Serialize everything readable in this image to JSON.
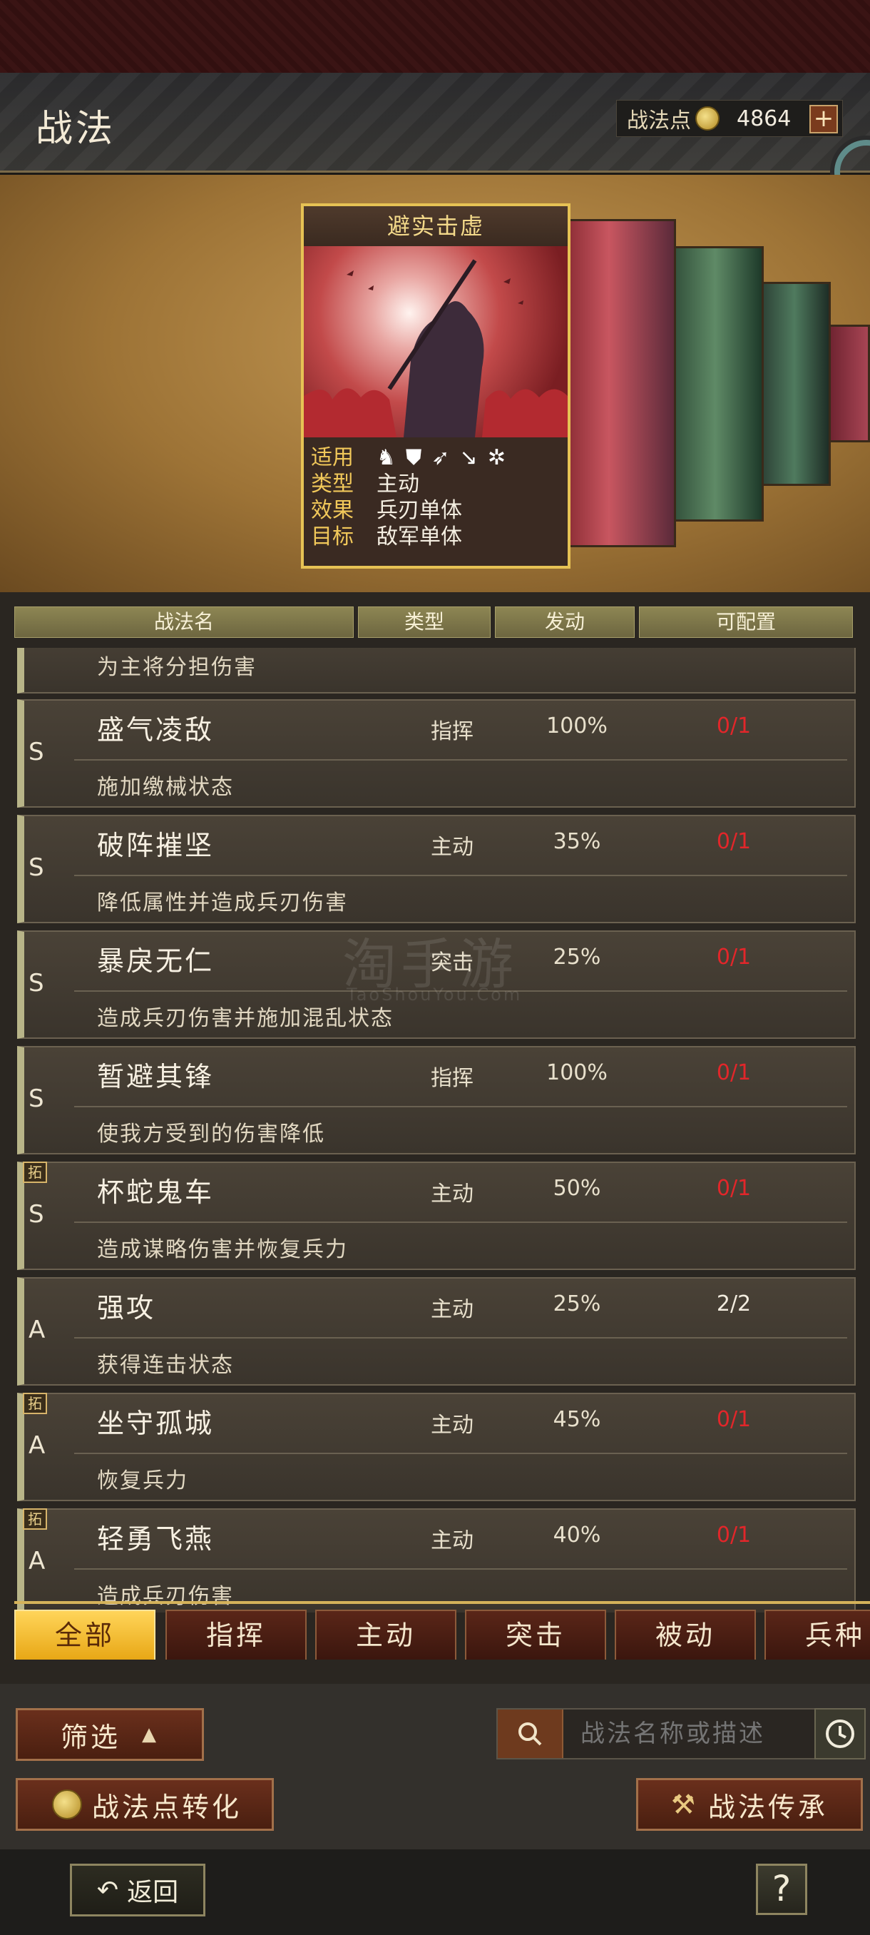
{
  "header": {
    "title": "战法",
    "points_label": "战法点",
    "points_value": "4864",
    "plus_label": "+"
  },
  "featured_card": {
    "name": "避实击虚",
    "fields": [
      {
        "key": "适用",
        "icons": [
          "cavalry-icon",
          "shield-icon",
          "archer-icon",
          "spear-icon",
          "siege-wheel-icon"
        ]
      },
      {
        "key": "类型",
        "value": "主动"
      },
      {
        "key": "效果",
        "value": "兵刃单体"
      },
      {
        "key": "目标",
        "value": "敌军单体"
      }
    ]
  },
  "columns": [
    "战法名",
    "类型",
    "发动",
    "可配置"
  ],
  "partial_top_desc": "为主将分担伤害",
  "rows": [
    {
      "grade": "S",
      "tag": "",
      "name": "盛气凌敌",
      "type": "指挥",
      "rate": "100%",
      "config": "0/1",
      "config_status": "red",
      "desc": "施加缴械状态"
    },
    {
      "grade": "S",
      "tag": "",
      "name": "破阵摧坚",
      "type": "主动",
      "rate": "35%",
      "config": "0/1",
      "config_status": "red",
      "desc": "降低属性并造成兵刃伤害"
    },
    {
      "grade": "S",
      "tag": "",
      "name": "暴戾无仁",
      "type": "突击",
      "rate": "25%",
      "config": "0/1",
      "config_status": "red",
      "desc": "造成兵刃伤害并施加混乱状态"
    },
    {
      "grade": "S",
      "tag": "",
      "name": "暂避其锋",
      "type": "指挥",
      "rate": "100%",
      "config": "0/1",
      "config_status": "red",
      "desc": "使我方受到的伤害降低"
    },
    {
      "grade": "S",
      "tag": "拓",
      "name": "杯蛇鬼车",
      "type": "主动",
      "rate": "50%",
      "config": "0/1",
      "config_status": "red",
      "desc": "造成谋略伤害并恢复兵力"
    },
    {
      "grade": "A",
      "tag": "",
      "name": "强攻",
      "type": "主动",
      "rate": "25%",
      "config": "2/2",
      "config_status": "white",
      "desc": "获得连击状态"
    },
    {
      "grade": "A",
      "tag": "拓",
      "name": "坐守孤城",
      "type": "主动",
      "rate": "45%",
      "config": "0/1",
      "config_status": "red",
      "desc": "恢复兵力"
    },
    {
      "grade": "A",
      "tag": "拓",
      "name": "轻勇飞燕",
      "type": "主动",
      "rate": "40%",
      "config": "0/1",
      "config_status": "red",
      "desc": "造成兵刃伤害"
    }
  ],
  "tabs": [
    {
      "label": "全部",
      "active": true
    },
    {
      "label": "指挥",
      "active": false
    },
    {
      "label": "主动",
      "active": false
    },
    {
      "label": "突击",
      "active": false
    },
    {
      "label": "被动",
      "active": false
    },
    {
      "label": "兵种",
      "active": false
    }
  ],
  "controls": {
    "filter_label": "筛选",
    "search_placeholder": "战法名称或描述",
    "convert_label": "战法点转化",
    "inherit_label": "战法传承"
  },
  "footer": {
    "back_label": "返回",
    "help_label": "?"
  },
  "watermark": {
    "text": "淘手游",
    "sub": "TaoShouYou.Com"
  },
  "colors": {
    "accent_gold": "#e6c254",
    "config_red": "#e2262a",
    "tab_active": "#f0b62a"
  }
}
